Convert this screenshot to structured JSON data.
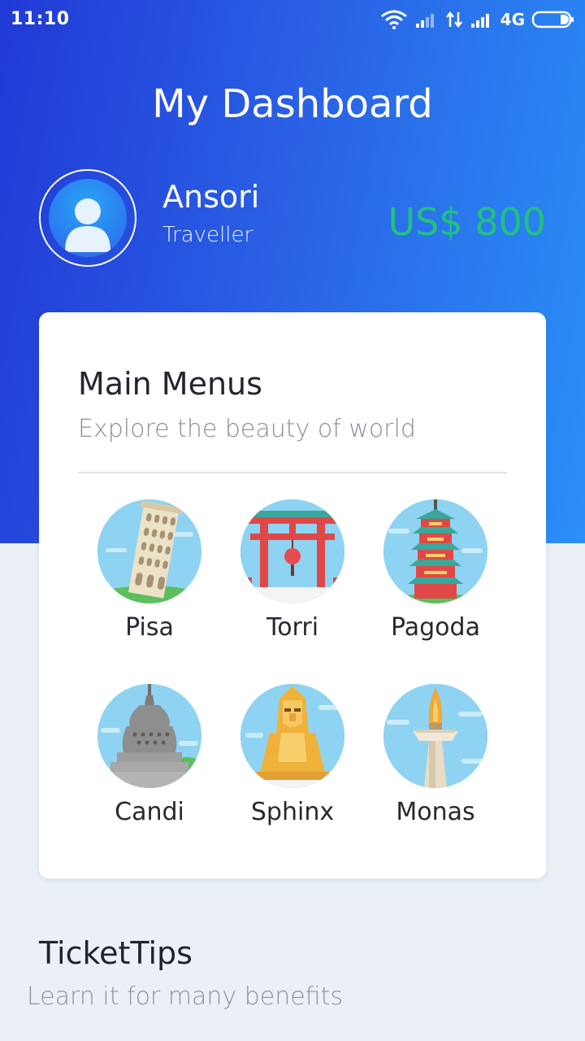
{
  "status_bar": {
    "time": "11:10",
    "network": "4G",
    "icons": [
      "wifi-icon",
      "signal-icon",
      "data-arrows-icon",
      "signal-icon",
      "battery-icon"
    ]
  },
  "header": {
    "title": "My Dashboard"
  },
  "profile": {
    "name": "Ansori",
    "role": "Traveller",
    "balance": "US$ 800",
    "avatar_icon": "user-avatar-icon"
  },
  "main_menu": {
    "title": "Main Menus",
    "subtitle": "Explore the beauty of world",
    "items": [
      {
        "label": "Pisa",
        "icon": "pisa-tower-icon"
      },
      {
        "label": "Torri",
        "icon": "torii-gate-icon"
      },
      {
        "label": "Pagoda",
        "icon": "pagoda-icon"
      },
      {
        "label": "Candi",
        "icon": "candi-temple-icon"
      },
      {
        "label": "Sphinx",
        "icon": "sphinx-icon"
      },
      {
        "label": "Monas",
        "icon": "monas-monument-icon"
      }
    ]
  },
  "ticket_tips": {
    "title": "TicketTips",
    "subtitle": "Learn it for many benefits"
  },
  "colors": {
    "gradient_start": "#2139d6",
    "gradient_end": "#2a8ff6",
    "balance": "#21c180",
    "background": "#ebf0f7",
    "icon_sky": "#7fcdf0"
  }
}
